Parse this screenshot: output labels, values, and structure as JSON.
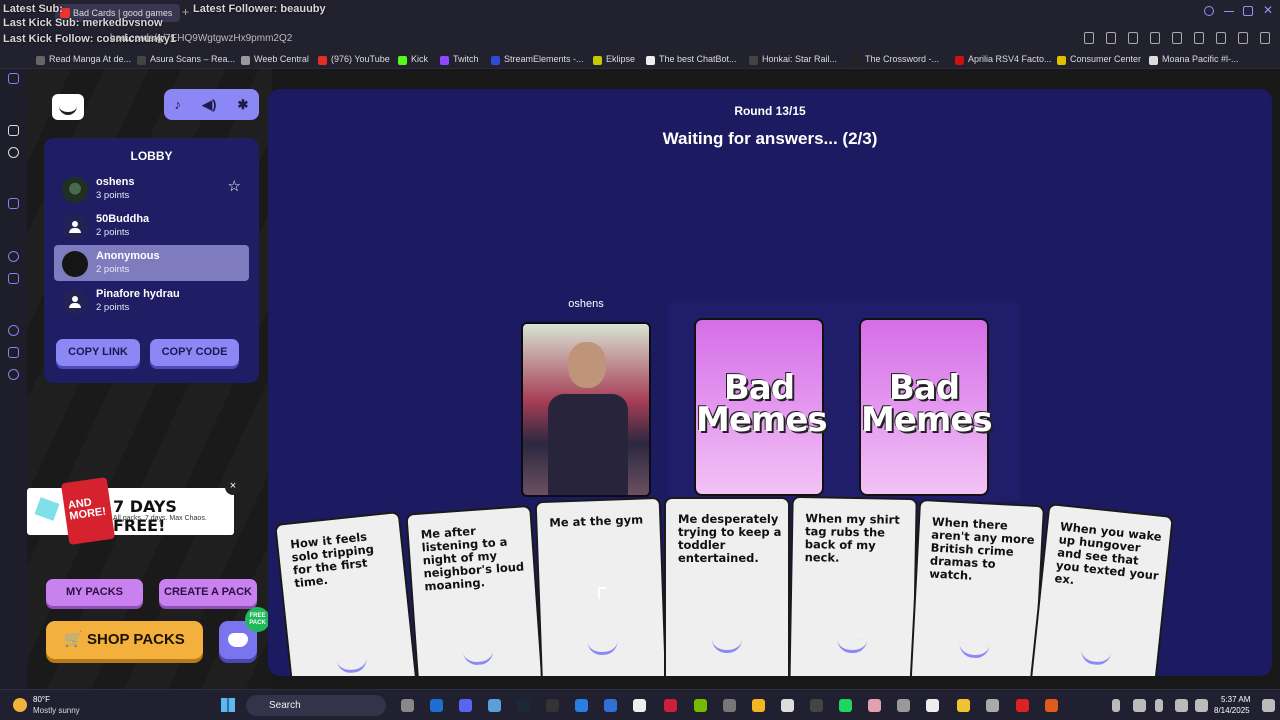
{
  "browser": {
    "tab_title": "Bad Cards | good games",
    "new_tab_symbol": "+",
    "url": "bad.cards/g/7EHQ9WgtgwzHx9pmm2Q2",
    "bookmarks": [
      {
        "label": "Read Manga At de...",
        "color": "#666666"
      },
      {
        "label": "Asura Scans – Rea...",
        "color": "#444444"
      },
      {
        "label": "Weeb Central",
        "color": "#999999"
      },
      {
        "label": "(976) YouTube",
        "color": "#e52d27"
      },
      {
        "label": "Kick",
        "color": "#53fc18"
      },
      {
        "label": "Twitch",
        "color": "#9146ff"
      },
      {
        "label": "StreamElements -...",
        "color": "#2f4bd6"
      },
      {
        "label": "Eklipse",
        "color": "#c8c800"
      },
      {
        "label": "The best ChatBot...",
        "color": "#eeeeee"
      },
      {
        "label": "Honkai: Star Rail...",
        "color": "#444444"
      },
      {
        "label": "The Crossword -...",
        "color": "#222222"
      },
      {
        "label": "Aprilia RSV4 Facto...",
        "color": "#cc1111"
      },
      {
        "label": "Consumer Center",
        "color": "#e0c000"
      },
      {
        "label": "Moana Pacific #l-...",
        "color": "#dddddd"
      }
    ]
  },
  "stream_overlay": {
    "line1": "Latest Sub:",
    "line1b": "Latest Follower: beauuby",
    "line2": "Last Kick Sub: merkedbysnow",
    "line3": "Last Kick Follow: cosmicmunky1"
  },
  "lobby": {
    "title": "LOBBY",
    "players": [
      {
        "name": "oshens",
        "points": "3 points"
      },
      {
        "name": "50Buddha",
        "points": "2 points"
      },
      {
        "name": "Anonymous",
        "points": "2 points"
      },
      {
        "name": "Pinafore hydrau",
        "points": "2 points"
      }
    ],
    "copy_link": "COPY LINK",
    "copy_code": "COPY CODE"
  },
  "promo": {
    "badge": "AND MORE!",
    "headline": "7 DAYS FREE!",
    "sub": "All packs. 7 days. Max Chaos.",
    "close": "×"
  },
  "buttons": {
    "my_packs": "MY PACKS",
    "create_pack": "CREATE A PACK",
    "shop_packs": "SHOP PACKS",
    "free_badge": "FREE PACK"
  },
  "game": {
    "round": "Round 13/15",
    "status": "Waiting for answers... (2/3)",
    "played_by": "oshens",
    "card_back_label": "Bad Memes",
    "hand": [
      "How it feels solo tripping for the first time.",
      "Me after listening to a night of my neighbor's loud moaning.",
      "Me at the gym",
      "Me desperately trying to keep a toddler entertained.",
      "When my shirt tag rubs the back of my neck.",
      "When there aren't any more British crime dramas to watch.",
      "When you wake up hungover and see that you texted your ex."
    ]
  },
  "taskbar": {
    "temperature": "80°F",
    "weather": "Mostly sunny",
    "search": "Search",
    "time": "5:37 AM",
    "date": "8/14/2025"
  }
}
